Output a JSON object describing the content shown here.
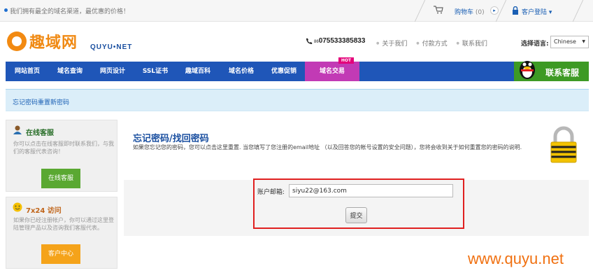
{
  "topbar": {
    "welcome": "我们拥有最全的域名渠道，最优惠的价格！",
    "cart_label": "购物车",
    "cart_count": "(0)",
    "login_label": "客户登陆 ▾"
  },
  "header": {
    "logo_cn": "趣域网",
    "logo_en": "QUYU•NET",
    "phone_prefix": "86",
    "phone": "075533385833",
    "links": [
      "关于我们",
      "付款方式",
      "联系我们"
    ],
    "lang_label": "选择语言:",
    "lang_value": "Chinese"
  },
  "nav": {
    "items": [
      "网站首页",
      "域名查询",
      "网页设计",
      "SSL证书",
      "趣域百科",
      "域名价格",
      "优惠促销",
      "域名交易"
    ],
    "hot_badge": "HOT",
    "qq_label": "联系客服"
  },
  "breadcrumb": "忘记密码重置新密码",
  "sidebar": {
    "online": {
      "title": "在线客服",
      "text": "你可以点击在线客服即时联系我们，与我们的客服代表咨询！",
      "button": "在线客服"
    },
    "support": {
      "title": "7x24 访问",
      "text": "如果你已经注册帐户，你可以通过这里登陆管理产品以及咨询我们客服代表。",
      "button": "客户中心"
    }
  },
  "main": {
    "title": "忘记密码/找回密码",
    "description": "如果您忘记您的密码，您可以点击这里重置. 当您填写了您注册的email地址 （以及回答您的帐号设置的安全问题），您将会收到关于如何重置您的密码的说明.",
    "email_label": "账户邮箱:",
    "email_value": "siyu22@163.com",
    "submit_label": "提交"
  },
  "watermark": "www.quyu.net",
  "colors": {
    "nav_blue": "#1f56b8",
    "nav_active": "#c23ab5",
    "green_button": "#5aa832",
    "orange_button": "#f5a31a",
    "highlight_red": "#e02020"
  }
}
